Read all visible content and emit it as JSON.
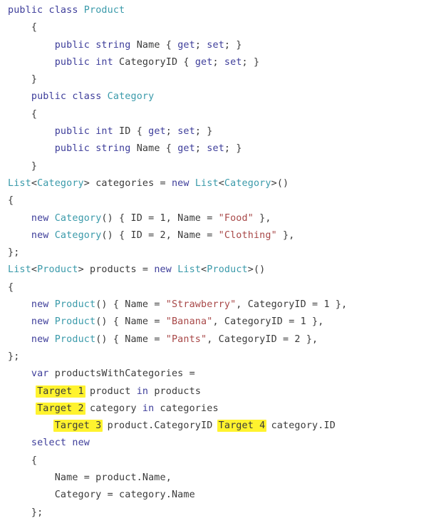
{
  "colors": {
    "keyword": "#3d3d9a",
    "type": "#3a9aaa",
    "string": "#a84848",
    "plain": "#3a3a3a",
    "highlight": "#fff32e",
    "background": "#ffffff"
  },
  "code_lines": [
    {
      "indent": "",
      "tokens": [
        {
          "t": "kw",
          "v": "public"
        },
        {
          "t": "plain",
          "v": " "
        },
        {
          "t": "kw",
          "v": "class"
        },
        {
          "t": "plain",
          "v": " "
        },
        {
          "t": "type",
          "v": "Product"
        }
      ]
    },
    {
      "indent": "    ",
      "tokens": [
        {
          "t": "plain",
          "v": "{"
        }
      ]
    },
    {
      "indent": "        ",
      "tokens": [
        {
          "t": "kw",
          "v": "public"
        },
        {
          "t": "plain",
          "v": " "
        },
        {
          "t": "kw",
          "v": "string"
        },
        {
          "t": "plain",
          "v": " Name { "
        },
        {
          "t": "kw",
          "v": "get"
        },
        {
          "t": "plain",
          "v": "; "
        },
        {
          "t": "kw",
          "v": "set"
        },
        {
          "t": "plain",
          "v": "; }"
        }
      ]
    },
    {
      "indent": "        ",
      "tokens": [
        {
          "t": "kw",
          "v": "public"
        },
        {
          "t": "plain",
          "v": " "
        },
        {
          "t": "kw",
          "v": "int"
        },
        {
          "t": "plain",
          "v": " CategoryID { "
        },
        {
          "t": "kw",
          "v": "get"
        },
        {
          "t": "plain",
          "v": "; "
        },
        {
          "t": "kw",
          "v": "set"
        },
        {
          "t": "plain",
          "v": "; }"
        }
      ]
    },
    {
      "indent": "    ",
      "tokens": [
        {
          "t": "plain",
          "v": "}"
        }
      ]
    },
    {
      "indent": "    ",
      "tokens": [
        {
          "t": "kw",
          "v": "public"
        },
        {
          "t": "plain",
          "v": " "
        },
        {
          "t": "kw",
          "v": "class"
        },
        {
          "t": "plain",
          "v": " "
        },
        {
          "t": "type",
          "v": "Category"
        }
      ]
    },
    {
      "indent": "    ",
      "tokens": [
        {
          "t": "plain",
          "v": "{"
        }
      ]
    },
    {
      "indent": "        ",
      "tokens": [
        {
          "t": "kw",
          "v": "public"
        },
        {
          "t": "plain",
          "v": " "
        },
        {
          "t": "kw",
          "v": "int"
        },
        {
          "t": "plain",
          "v": " ID { "
        },
        {
          "t": "kw",
          "v": "get"
        },
        {
          "t": "plain",
          "v": "; "
        },
        {
          "t": "kw",
          "v": "set"
        },
        {
          "t": "plain",
          "v": "; }"
        }
      ]
    },
    {
      "indent": "        ",
      "tokens": [
        {
          "t": "kw",
          "v": "public"
        },
        {
          "t": "plain",
          "v": " "
        },
        {
          "t": "kw",
          "v": "string"
        },
        {
          "t": "plain",
          "v": " Name { "
        },
        {
          "t": "kw",
          "v": "get"
        },
        {
          "t": "plain",
          "v": "; "
        },
        {
          "t": "kw",
          "v": "set"
        },
        {
          "t": "plain",
          "v": "; }"
        }
      ]
    },
    {
      "indent": "    ",
      "tokens": [
        {
          "t": "plain",
          "v": "}"
        }
      ]
    },
    {
      "indent": "",
      "tokens": [
        {
          "t": "type",
          "v": "List"
        },
        {
          "t": "plain",
          "v": "<"
        },
        {
          "t": "type",
          "v": "Category"
        },
        {
          "t": "plain",
          "v": "> categories = "
        },
        {
          "t": "kw",
          "v": "new"
        },
        {
          "t": "plain",
          "v": " "
        },
        {
          "t": "type",
          "v": "List"
        },
        {
          "t": "plain",
          "v": "<"
        },
        {
          "t": "type",
          "v": "Category"
        },
        {
          "t": "plain",
          "v": ">()"
        }
      ]
    },
    {
      "indent": "",
      "tokens": [
        {
          "t": "plain",
          "v": "{"
        }
      ]
    },
    {
      "indent": "    ",
      "tokens": [
        {
          "t": "kw",
          "v": "new"
        },
        {
          "t": "plain",
          "v": " "
        },
        {
          "t": "type",
          "v": "Category"
        },
        {
          "t": "plain",
          "v": "() { ID = 1, Name = "
        },
        {
          "t": "str",
          "v": "\"Food\""
        },
        {
          "t": "plain",
          "v": " },"
        }
      ]
    },
    {
      "indent": "    ",
      "tokens": [
        {
          "t": "kw",
          "v": "new"
        },
        {
          "t": "plain",
          "v": " "
        },
        {
          "t": "type",
          "v": "Category"
        },
        {
          "t": "plain",
          "v": "() { ID = 2, Name = "
        },
        {
          "t": "str",
          "v": "\"Clothing\""
        },
        {
          "t": "plain",
          "v": " },"
        }
      ]
    },
    {
      "indent": "",
      "tokens": [
        {
          "t": "plain",
          "v": "};"
        }
      ]
    },
    {
      "indent": "",
      "tokens": [
        {
          "t": "type",
          "v": "List"
        },
        {
          "t": "plain",
          "v": "<"
        },
        {
          "t": "type",
          "v": "Product"
        },
        {
          "t": "plain",
          "v": "> products = "
        },
        {
          "t": "kw",
          "v": "new"
        },
        {
          "t": "plain",
          "v": " "
        },
        {
          "t": "type",
          "v": "List"
        },
        {
          "t": "plain",
          "v": "<"
        },
        {
          "t": "type",
          "v": "Product"
        },
        {
          "t": "plain",
          "v": ">()"
        }
      ]
    },
    {
      "indent": "",
      "tokens": [
        {
          "t": "plain",
          "v": "{"
        }
      ]
    },
    {
      "indent": "    ",
      "tokens": [
        {
          "t": "kw",
          "v": "new"
        },
        {
          "t": "plain",
          "v": " "
        },
        {
          "t": "type",
          "v": "Product"
        },
        {
          "t": "plain",
          "v": "() { Name = "
        },
        {
          "t": "str",
          "v": "\"Strawberry\""
        },
        {
          "t": "plain",
          "v": ", CategoryID = 1 },"
        }
      ]
    },
    {
      "indent": "    ",
      "tokens": [
        {
          "t": "kw",
          "v": "new"
        },
        {
          "t": "plain",
          "v": " "
        },
        {
          "t": "type",
          "v": "Product"
        },
        {
          "t": "plain",
          "v": "() { Name = "
        },
        {
          "t": "str",
          "v": "\"Banana\""
        },
        {
          "t": "plain",
          "v": ", CategoryID = 1 },"
        }
      ]
    },
    {
      "indent": "    ",
      "tokens": [
        {
          "t": "kw",
          "v": "new"
        },
        {
          "t": "plain",
          "v": " "
        },
        {
          "t": "type",
          "v": "Product"
        },
        {
          "t": "plain",
          "v": "() { Name = "
        },
        {
          "t": "str",
          "v": "\"Pants\""
        },
        {
          "t": "plain",
          "v": ", CategoryID = 2 },"
        }
      ]
    },
    {
      "indent": "",
      "tokens": [
        {
          "t": "plain",
          "v": "};"
        }
      ]
    },
    {
      "indent": "    ",
      "tokens": [
        {
          "t": "kw",
          "v": "var"
        },
        {
          "t": "plain",
          "v": " productsWithCategories ="
        }
      ]
    },
    {
      "indent": "     ",
      "tokens": [
        {
          "t": "hl",
          "v": "Target 1"
        },
        {
          "t": "plain",
          "v": " product "
        },
        {
          "t": "kw",
          "v": "in"
        },
        {
          "t": "plain",
          "v": " products"
        }
      ]
    },
    {
      "indent": "     ",
      "tokens": [
        {
          "t": "hl",
          "v": "Target 2"
        },
        {
          "t": "plain",
          "v": " category "
        },
        {
          "t": "kw",
          "v": "in"
        },
        {
          "t": "plain",
          "v": " categories"
        }
      ]
    },
    {
      "indent": "        ",
      "tokens": [
        {
          "t": "hl",
          "v": "Target 3"
        },
        {
          "t": "plain",
          "v": " product.CategoryID "
        },
        {
          "t": "hl",
          "v": "Target 4"
        },
        {
          "t": "plain",
          "v": " category.ID"
        }
      ]
    },
    {
      "indent": "    ",
      "tokens": [
        {
          "t": "kw",
          "v": "select"
        },
        {
          "t": "plain",
          "v": " "
        },
        {
          "t": "kw",
          "v": "new"
        }
      ]
    },
    {
      "indent": "    ",
      "tokens": [
        {
          "t": "plain",
          "v": "{"
        }
      ]
    },
    {
      "indent": "        ",
      "tokens": [
        {
          "t": "plain",
          "v": "Name = product.Name,"
        }
      ]
    },
    {
      "indent": "        ",
      "tokens": [
        {
          "t": "plain",
          "v": "Category = category.Name"
        }
      ]
    },
    {
      "indent": "    ",
      "tokens": [
        {
          "t": "plain",
          "v": "};"
        }
      ]
    }
  ]
}
